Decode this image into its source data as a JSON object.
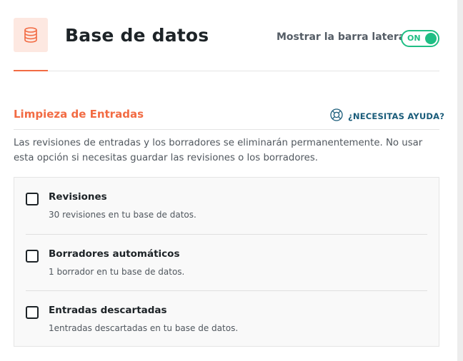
{
  "header": {
    "title": "Base de datos",
    "icon": "database-icon",
    "sidebar_toggle_label": "Mostrar la barra lateral",
    "sidebar_toggle_state": "ON",
    "accent_color": "#f26b43",
    "toggle_color": "#1fbe84"
  },
  "section": {
    "title": "Limpieza de Entradas",
    "help_label": "¿NECESITAS AYUDA?",
    "help_icon": "lifebuoy-icon",
    "description": "Las revisiones de entradas y los borradores se eliminarán permanentemente. No usar esta opción si necesitas guardar las revisiones o los borradores."
  },
  "options": [
    {
      "label": "Revisiones",
      "description": "30 revisiones en tu base de datos.",
      "checked": false
    },
    {
      "label": "Borradores automáticos",
      "description": "1 borrador en tu base de datos.",
      "checked": false
    },
    {
      "label": "Entradas descartadas",
      "description": "1entradas descartadas en tu base de datos.",
      "checked": false
    }
  ]
}
